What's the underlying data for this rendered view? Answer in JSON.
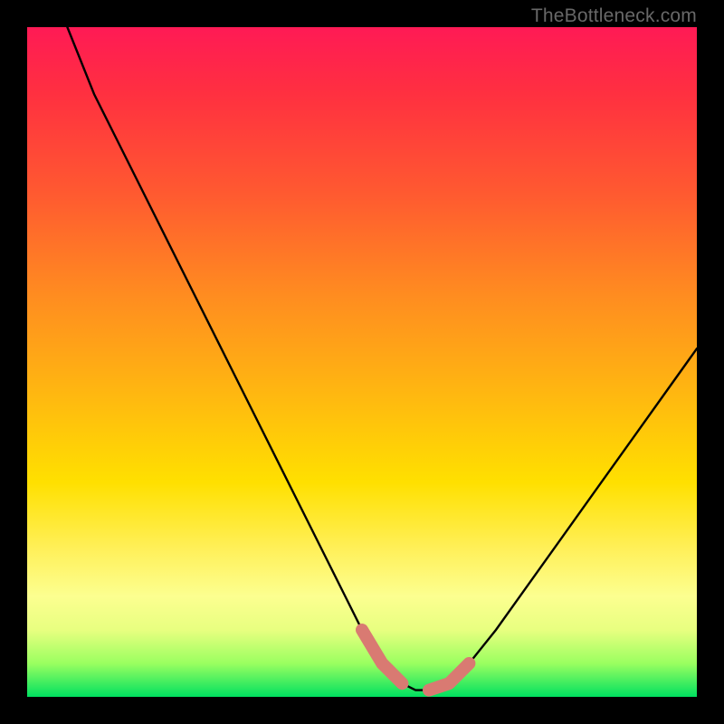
{
  "watermark": "TheBottleneck.com",
  "chart_data": {
    "type": "line",
    "title": "",
    "xlabel": "",
    "ylabel": "",
    "xlim": [
      0,
      100
    ],
    "ylim": [
      0,
      100
    ],
    "series": [
      {
        "name": "bottleneck-curve",
        "x": [
          6,
          10,
          15,
          20,
          25,
          30,
          35,
          40,
          45,
          50,
          53,
          56,
          58,
          60,
          63,
          66,
          70,
          75,
          80,
          85,
          90,
          95,
          100
        ],
        "values": [
          100,
          90,
          80,
          70,
          60,
          50,
          40,
          30,
          20,
          10,
          5,
          2,
          1,
          1,
          2,
          5,
          10,
          17,
          24,
          31,
          38,
          45,
          52
        ]
      }
    ],
    "highlights": [
      {
        "name": "near-minimum-left",
        "x": [
          50,
          53,
          56
        ],
        "values": [
          10,
          5,
          2
        ]
      },
      {
        "name": "near-minimum-right",
        "x": [
          60,
          63,
          66
        ],
        "values": [
          1,
          2,
          5
        ]
      }
    ],
    "gradient_stops": [
      {
        "pos": 0.0,
        "color": "#ff1a55"
      },
      {
        "pos": 0.25,
        "color": "#ff5a30"
      },
      {
        "pos": 0.55,
        "color": "#ffb810"
      },
      {
        "pos": 0.78,
        "color": "#fff05a"
      },
      {
        "pos": 1.0,
        "color": "#00e060"
      }
    ]
  }
}
